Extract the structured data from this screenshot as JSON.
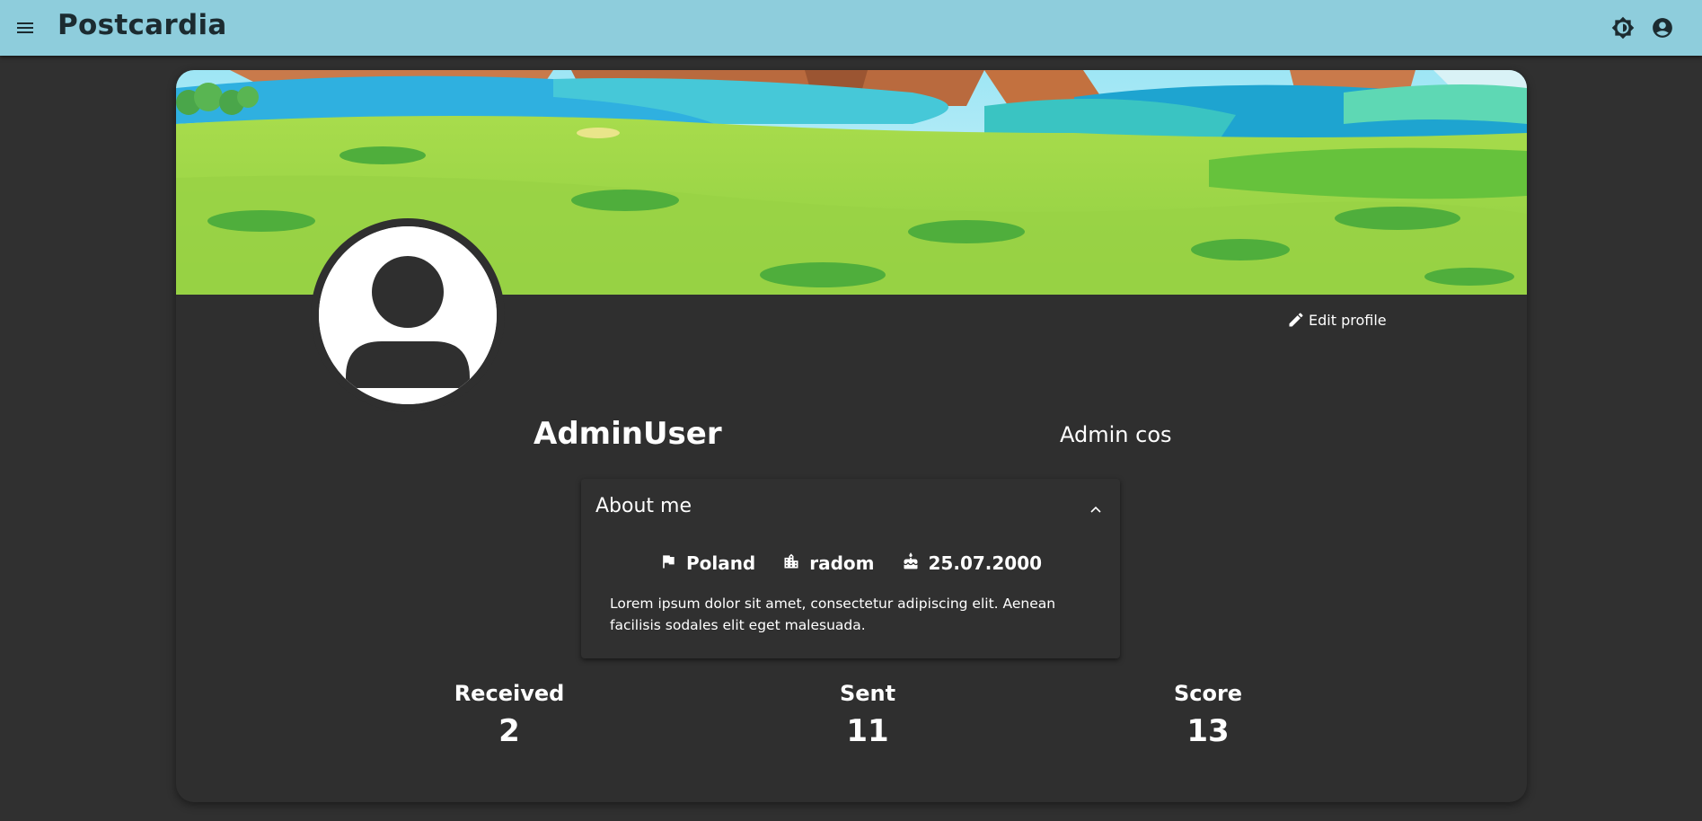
{
  "app": {
    "title": "Postcardia"
  },
  "topbar": {
    "menu_icon": "hamburger-menu-icon",
    "theme_icon": "brightness-icon",
    "account_icon": "account-circle-icon",
    "background": "#8ecddc"
  },
  "profile": {
    "username": "AdminUser",
    "role": "Admin cos",
    "edit_label": "Edit profile",
    "about": {
      "title": "About me",
      "country": "Poland",
      "city": "radom",
      "birthday": "25.07.2000",
      "bio": "Lorem ipsum dolor sit amet, consectetur adipiscing elit. Aenean facilisis sodales elit eget malesuada."
    },
    "stats": [
      {
        "label": "Received",
        "value": "2"
      },
      {
        "label": "Sent",
        "value": "11"
      },
      {
        "label": "Score",
        "value": "13"
      }
    ]
  },
  "colors": {
    "page_background": "#303030",
    "card_background": "#2f2f2f",
    "text": "#ffffff"
  }
}
